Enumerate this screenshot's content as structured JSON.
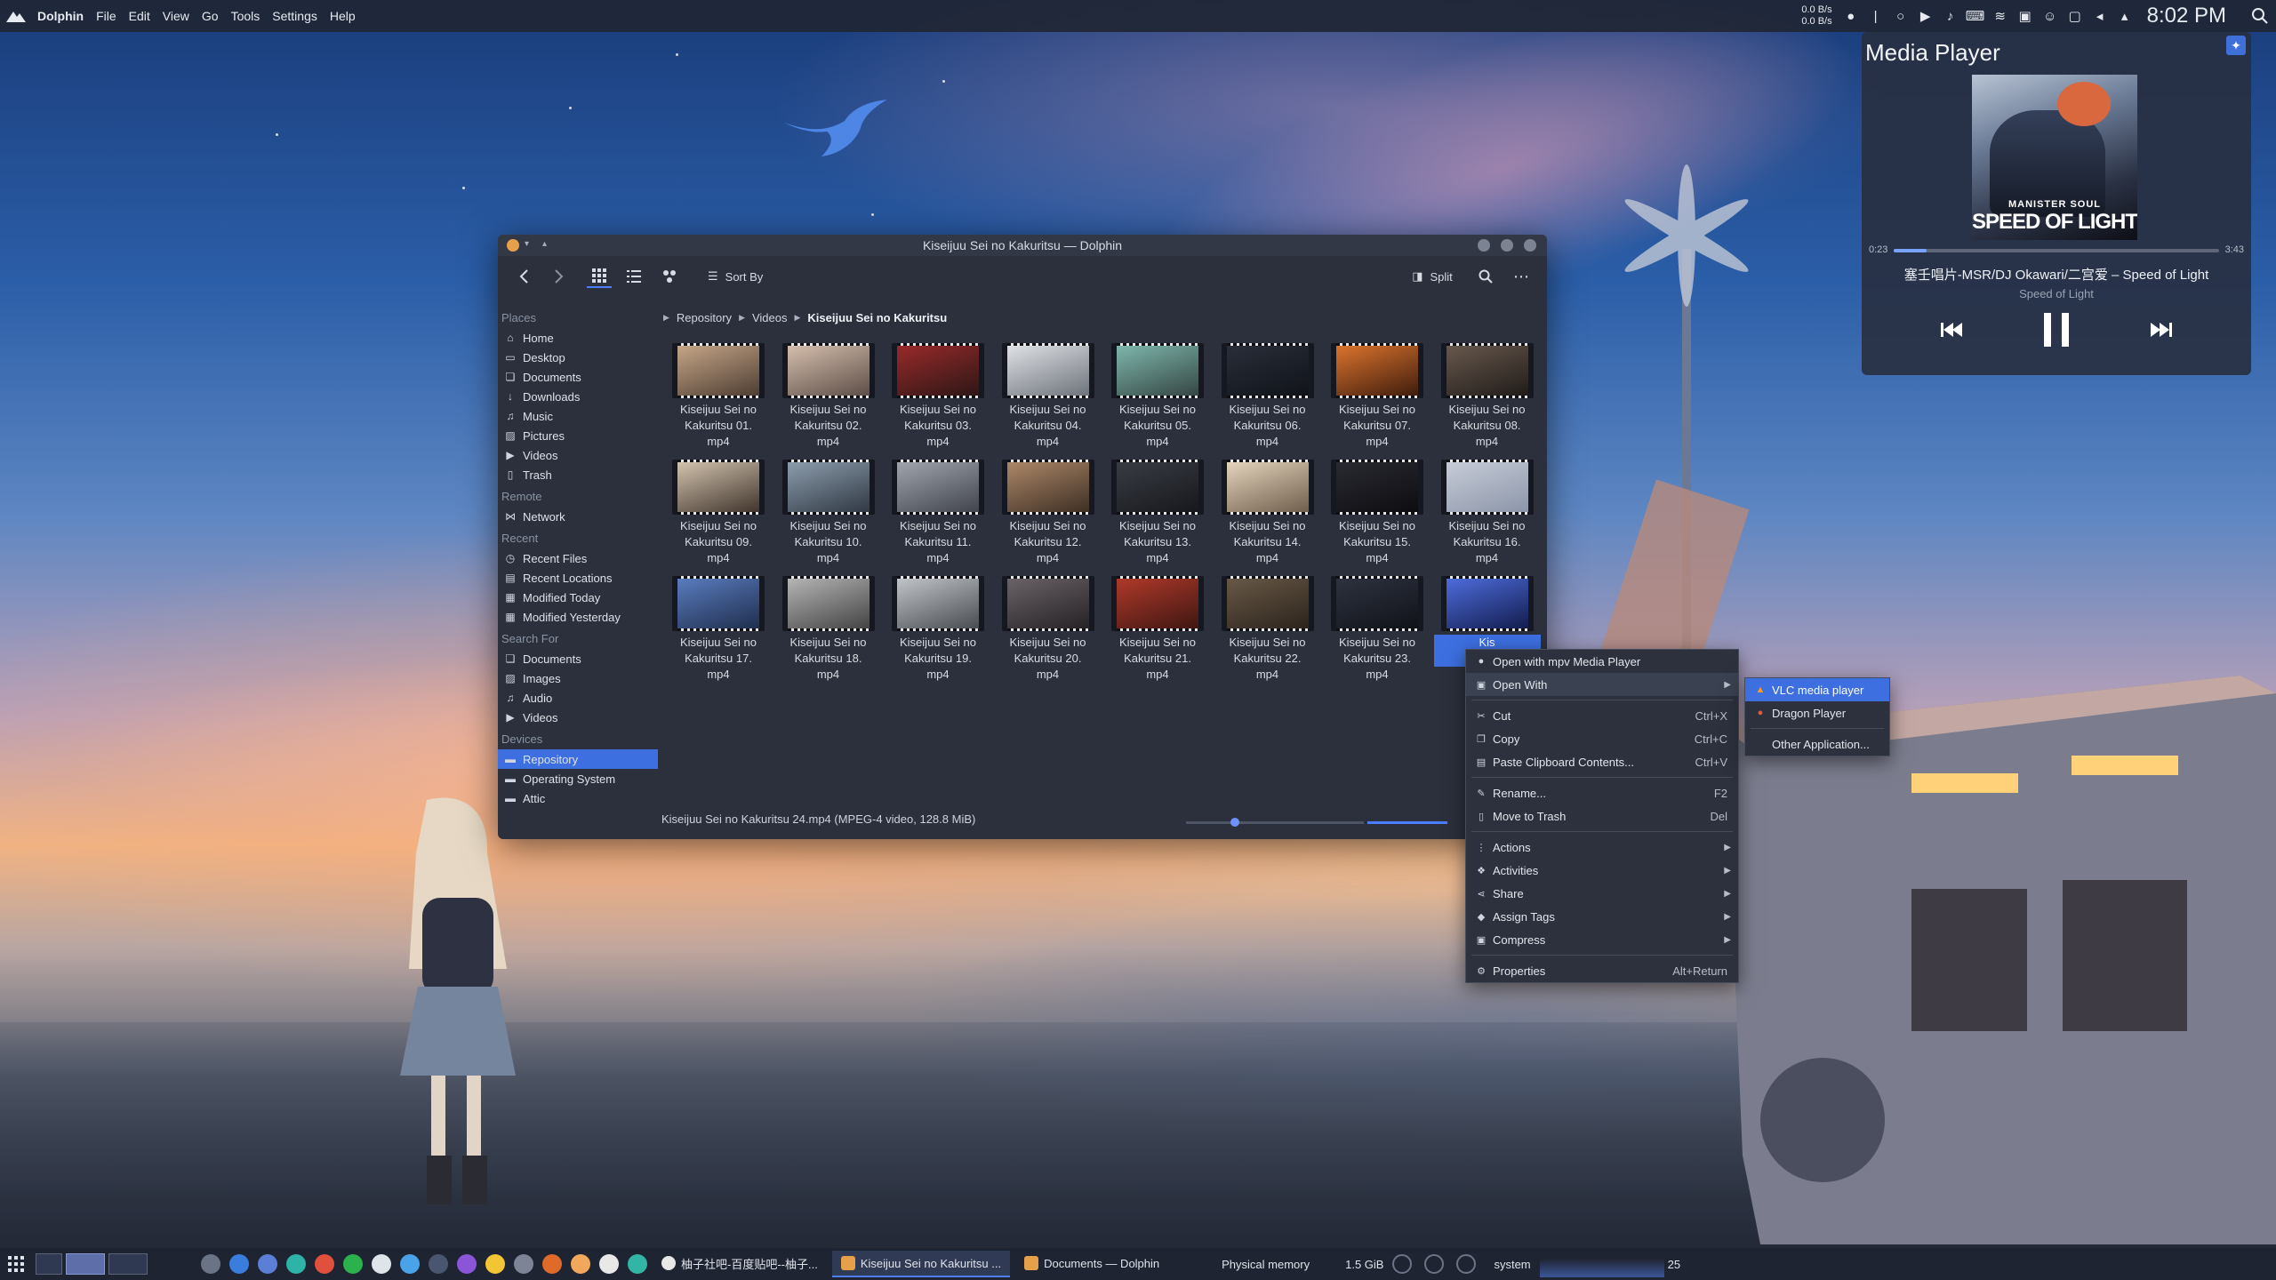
{
  "top_panel": {
    "app_name": "Dolphin",
    "menus": [
      "File",
      "Edit",
      "View",
      "Go",
      "Tools",
      "Settings",
      "Help"
    ],
    "net_down": "0.0 B/s",
    "net_up": "0.0 B/s",
    "clock": "8:02 PM"
  },
  "media_player": {
    "title": "Media Player",
    "album_brand": "MANISTER SOUL",
    "album_title": "SPEED OF LIGHT",
    "time_elapsed": "0:23",
    "time_total": "3:43",
    "progress": 0.1,
    "track": "塞壬唱片-MSR/DJ Okawari/二宫爱 – Speed of Light",
    "artist": "Speed of Light"
  },
  "dolphin": {
    "window_title": "Kiseijuu Sei no Kakuritsu — Dolphin",
    "toolbar": {
      "sort_by": "Sort By",
      "split": "Split"
    },
    "breadcrumb": [
      "Repository",
      "Videos",
      "Kiseijuu Sei no Kakuritsu"
    ],
    "sidebar": {
      "places_label": "Places",
      "places": [
        "Home",
        "Desktop",
        "Documents",
        "Downloads",
        "Music",
        "Pictures",
        "Videos",
        "Trash"
      ],
      "remote_label": "Remote",
      "remote": [
        "Network"
      ],
      "recent_label": "Recent",
      "recent": [
        "Recent Files",
        "Recent Locations",
        "Modified Today",
        "Modified Yesterday"
      ],
      "search_label": "Search For",
      "search": [
        "Documents",
        "Images",
        "Audio",
        "Videos"
      ],
      "devices_label": "Devices",
      "devices": [
        "Repository",
        "Operating System",
        "Attic"
      ]
    },
    "files": [
      {
        "l1": "Kiseijuu Sei no",
        "l2": "Kakuritsu 01.",
        "l3": "mp4"
      },
      {
        "l1": "Kiseijuu Sei no",
        "l2": "Kakuritsu 02.",
        "l3": "mp4"
      },
      {
        "l1": "Kiseijuu Sei no",
        "l2": "Kakuritsu 03.",
        "l3": "mp4"
      },
      {
        "l1": "Kiseijuu Sei no",
        "l2": "Kakuritsu 04.",
        "l3": "mp4"
      },
      {
        "l1": "Kiseijuu Sei no",
        "l2": "Kakuritsu 05.",
        "l3": "mp4"
      },
      {
        "l1": "Kiseijuu Sei no",
        "l2": "Kakuritsu 06.",
        "l3": "mp4"
      },
      {
        "l1": "Kiseijuu Sei no",
        "l2": "Kakuritsu 07.",
        "l3": "mp4"
      },
      {
        "l1": "Kiseijuu Sei no",
        "l2": "Kakuritsu 08.",
        "l3": "mp4"
      },
      {
        "l1": "Kiseijuu Sei no",
        "l2": "Kakuritsu 09.",
        "l3": "mp4"
      },
      {
        "l1": "Kiseijuu Sei no",
        "l2": "Kakuritsu 10.",
        "l3": "mp4"
      },
      {
        "l1": "Kiseijuu Sei no",
        "l2": "Kakuritsu 11.",
        "l3": "mp4"
      },
      {
        "l1": "Kiseijuu Sei no",
        "l2": "Kakuritsu 12.",
        "l3": "mp4"
      },
      {
        "l1": "Kiseijuu Sei no",
        "l2": "Kakuritsu 13.",
        "l3": "mp4"
      },
      {
        "l1": "Kiseijuu Sei no",
        "l2": "Kakuritsu 14.",
        "l3": "mp4"
      },
      {
        "l1": "Kiseijuu Sei no",
        "l2": "Kakuritsu 15.",
        "l3": "mp4"
      },
      {
        "l1": "Kiseijuu Sei no",
        "l2": "Kakuritsu 16.",
        "l3": "mp4"
      },
      {
        "l1": "Kiseijuu Sei no",
        "l2": "Kakuritsu 17.",
        "l3": "mp4"
      },
      {
        "l1": "Kiseijuu Sei no",
        "l2": "Kakuritsu 18.",
        "l3": "mp4"
      },
      {
        "l1": "Kiseijuu Sei no",
        "l2": "Kakuritsu 19.",
        "l3": "mp4"
      },
      {
        "l1": "Kiseijuu Sei no",
        "l2": "Kakuritsu 20.",
        "l3": "mp4"
      },
      {
        "l1": "Kiseijuu Sei no",
        "l2": "Kakuritsu 21.",
        "l3": "mp4"
      },
      {
        "l1": "Kiseijuu Sei no",
        "l2": "Kakuritsu 22.",
        "l3": "mp4"
      },
      {
        "l1": "Kiseijuu Sei no",
        "l2": "Kakuritsu 23.",
        "l3": "mp4"
      },
      {
        "l1": "Kis",
        "l2": "Ka",
        "l3": ""
      }
    ],
    "status_text": "Kiseijuu Sei no Kakuritsu 24.mp4 (MPEG-4 video, 128.8 MiB)"
  },
  "context_menu": {
    "open_with_mpv": "Open with mpv Media Player",
    "open_with": "Open With",
    "cut": "Cut",
    "cut_short": "Ctrl+X",
    "copy": "Copy",
    "copy_short": "Ctrl+C",
    "paste": "Paste Clipboard Contents...",
    "paste_short": "Ctrl+V",
    "rename": "Rename...",
    "rename_short": "F2",
    "trash": "Move to Trash",
    "trash_short": "Del",
    "actions": "Actions",
    "activities": "Activities",
    "share": "Share",
    "assign_tags": "Assign Tags",
    "compress": "Compress",
    "properties": "Properties",
    "properties_short": "Alt+Return"
  },
  "open_with_menu": {
    "vlc": "VLC media player",
    "dragon": "Dragon Player",
    "other": "Other Application..."
  },
  "taskbar": {
    "task1": "柚子社吧-百度贴吧--柚子...",
    "task2": "Kiseijuu Sei no Kakuritsu ...",
    "task3": "Documents — Dolphin",
    "mem_label": "Physical memory",
    "mem_value": "1.5 GiB",
    "sys_label": "system",
    "sys_value": "25"
  }
}
